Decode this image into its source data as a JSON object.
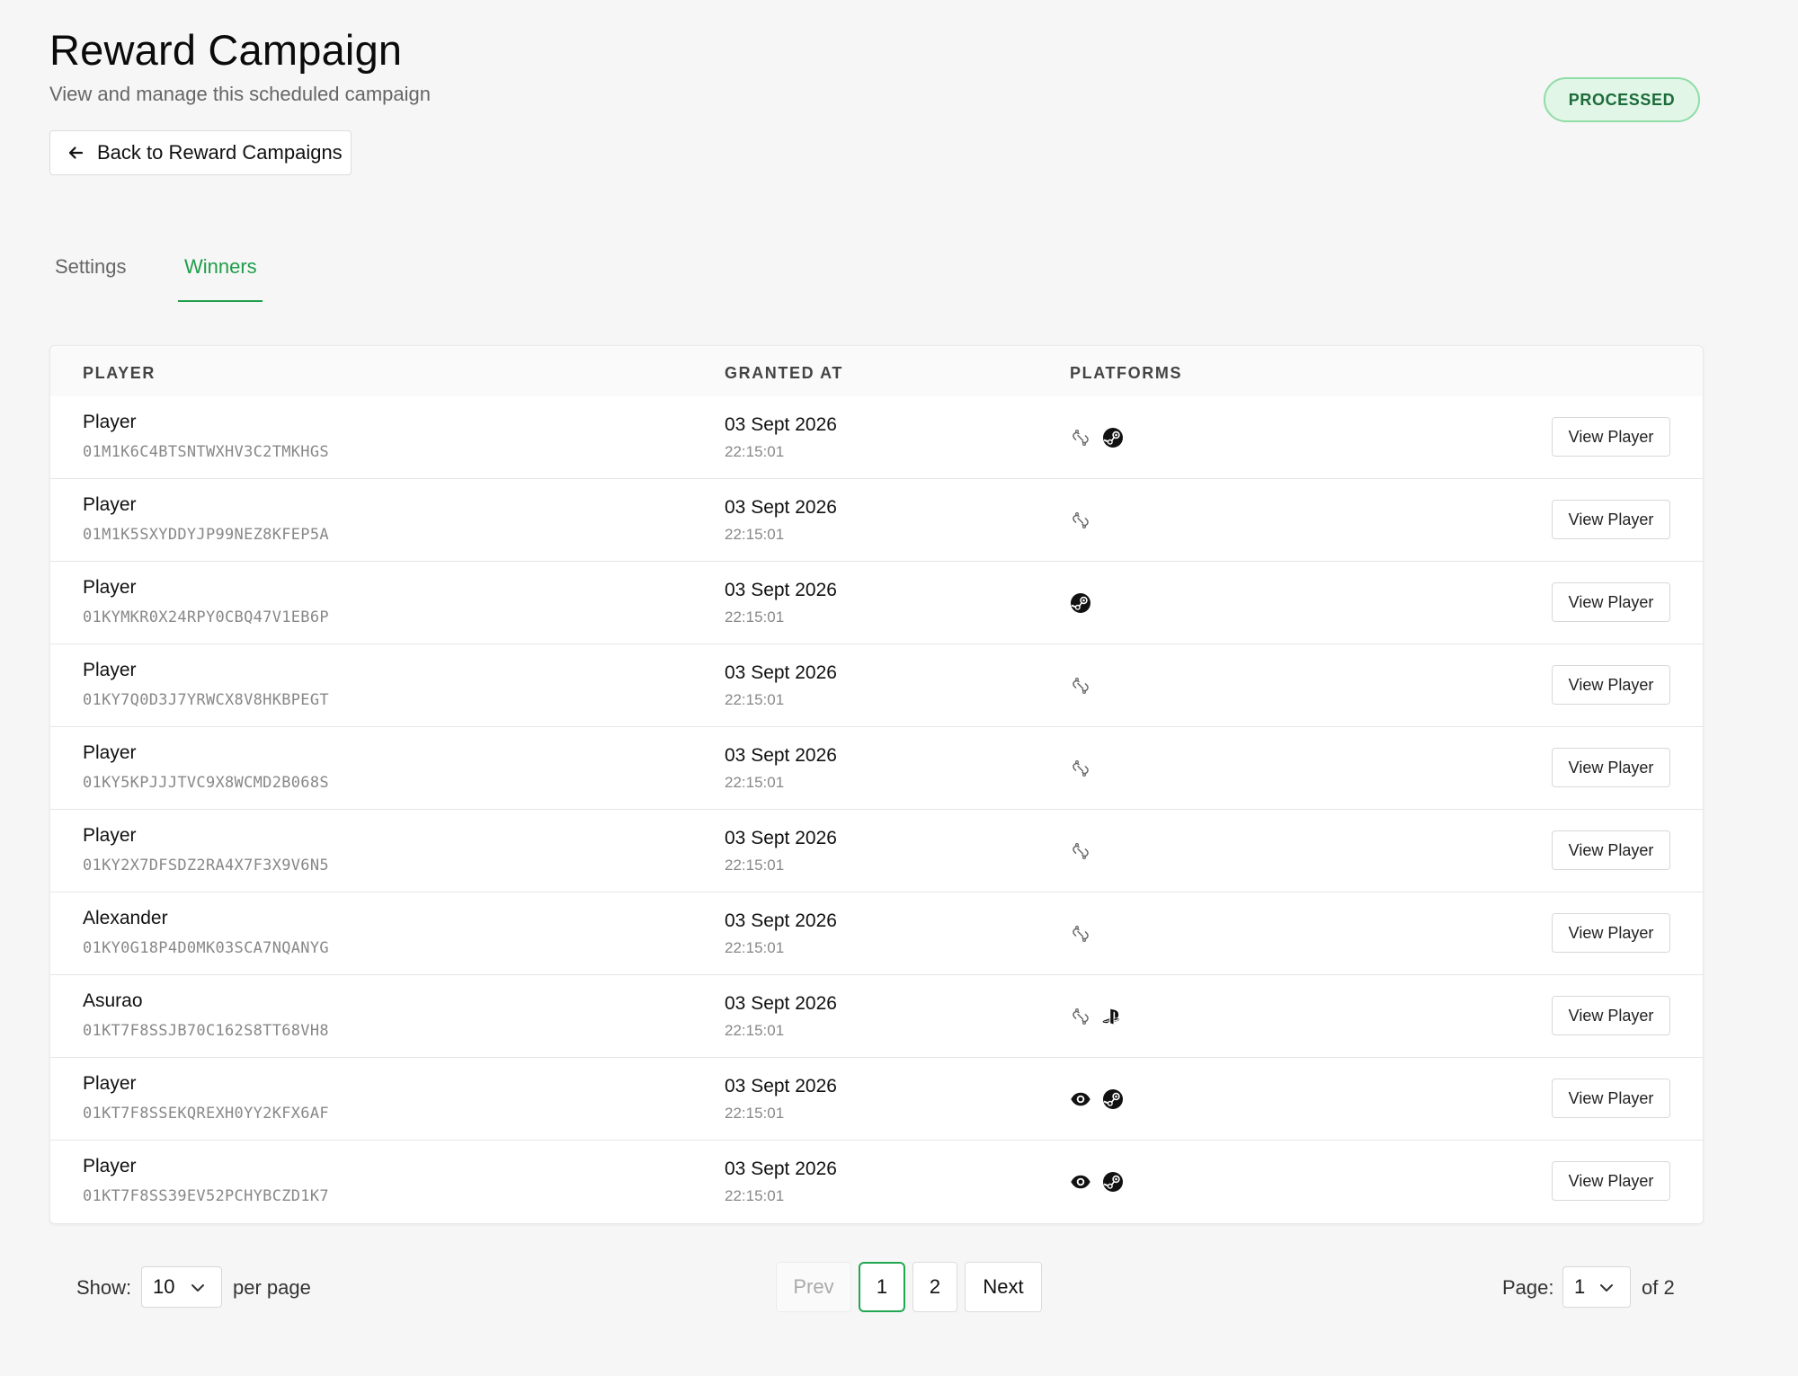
{
  "header": {
    "title": "Reward Campaign",
    "subtitle": "View and manage this scheduled campaign",
    "status": "PROCESSED",
    "back_label": "Back to Reward Campaigns"
  },
  "tabs": [
    {
      "label": "Settings",
      "active": false
    },
    {
      "label": "Winners",
      "active": true
    }
  ],
  "table": {
    "columns": [
      "PLAYER",
      "GRANTED AT",
      "PLATFORMS"
    ],
    "action_label": "View Player",
    "rows": [
      {
        "name": "Player",
        "id": "01M1K6C4BTSNTWXHV3C2TMKHGS",
        "date": "03 Sept 2026",
        "time": "22:15:01",
        "platforms": [
          "link-icon",
          "steam-icon"
        ]
      },
      {
        "name": "Player",
        "id": "01M1K5SXYDDYJP99NEZ8KFEP5A",
        "date": "03 Sept 2026",
        "time": "22:15:01",
        "platforms": [
          "link-icon"
        ]
      },
      {
        "name": "Player",
        "id": "01KYMKR0X24RPY0CBQ47V1EB6P",
        "date": "03 Sept 2026",
        "time": "22:15:01",
        "platforms": [
          "steam-icon"
        ]
      },
      {
        "name": "Player",
        "id": "01KY7Q0D3J7YRWCX8V8HKBPEGT",
        "date": "03 Sept 2026",
        "time": "22:15:01",
        "platforms": [
          "link-icon"
        ]
      },
      {
        "name": "Player",
        "id": "01KY5KPJJJTVC9X8WCMD2B068S",
        "date": "03 Sept 2026",
        "time": "22:15:01",
        "platforms": [
          "link-icon"
        ]
      },
      {
        "name": "Player",
        "id": "01KY2X7DFSDZ2RA4X7F3X9V6N5",
        "date": "03 Sept 2026",
        "time": "22:15:01",
        "platforms": [
          "link-icon"
        ]
      },
      {
        "name": "Alexander",
        "id": "01KY0G18P4D0MK03SCA7NQANYG",
        "date": "03 Sept 2026",
        "time": "22:15:01",
        "platforms": [
          "link-icon"
        ]
      },
      {
        "name": "Asurao",
        "id": "01KT7F8SSJB70C162S8TT68VH8",
        "date": "03 Sept 2026",
        "time": "22:15:01",
        "platforms": [
          "link-icon",
          "playstation-icon"
        ]
      },
      {
        "name": "Player",
        "id": "01KT7F8SSEKQREXH0YY2KFX6AF",
        "date": "03 Sept 2026",
        "time": "22:15:01",
        "platforms": [
          "eye-icon",
          "steam-icon"
        ]
      },
      {
        "name": "Player",
        "id": "01KT7F8SS39EV52PCHYBCZD1K7",
        "date": "03 Sept 2026",
        "time": "22:15:01",
        "platforms": [
          "eye-icon",
          "steam-icon"
        ]
      }
    ]
  },
  "pagination": {
    "show_label": "Show:",
    "per_page_value": "10",
    "per_page_label": "per page",
    "prev_label": "Prev",
    "pages": [
      "1",
      "2"
    ],
    "current_page": "1",
    "next_label": "Next",
    "page_label": "Page:",
    "page_select_value": "1",
    "of_label": "of 2"
  },
  "colors": {
    "accent": "#1f9e4a",
    "badge_bg": "#e1f6e7",
    "badge_border": "#8fdca7",
    "background": "#f6f6f6"
  }
}
